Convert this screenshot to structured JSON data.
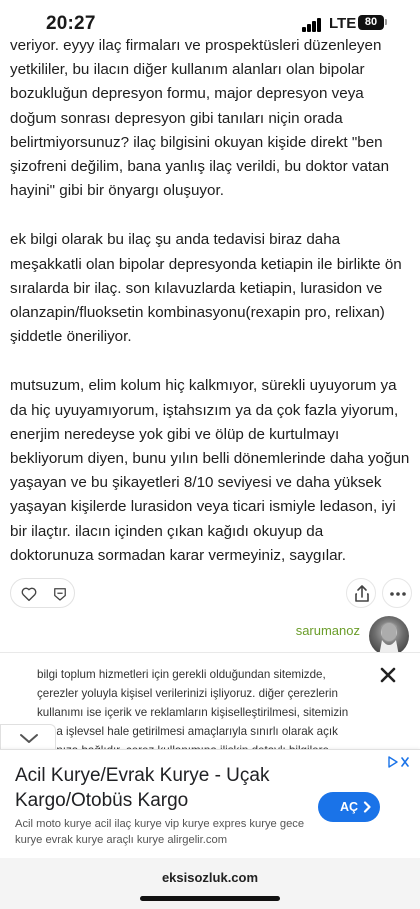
{
  "status_bar": {
    "time": "20:27",
    "network": "LTE",
    "battery": "80"
  },
  "entry": {
    "paragraphs": [
      "veriyor. eyyy ilaç firmaları ve prospektüsleri düzenleyen yetkililer, bu ilacın diğer kullanım alanları olan bipolar bozukluğun depresyon formu, major depresyon veya doğum sonrası depresyon gibi tanıları niçin orada belirtmiyorsunuz? ilaç bilgisini okuyan kişide direkt \"ben şizofreni değilim, bana yanlış ilaç verildi, bu doktor vatan hayini\" gibi bir önyargı oluşuyor.",
      "ek bilgi olarak bu ilaç şu anda tedavisi biraz daha meşakkatli olan bipolar depresyonda ketiapin ile birlikte ön sıralarda bir ilaç. son kılavuzlarda ketiapin, lurasidon ve olanzapin/fluoksetin kombinasyonu(rexapin pro, relixan) şiddetle öneriliyor.",
      "mutsuzum, elim kolum hiç kalkmıyor, sürekli uyuyorum ya da hiç uyuyamıyorum, iştahsızım ya da çok fazla yiyorum, enerjim neredeyse yok gibi ve ölüp de kurtulmayı bekliyorum diyen, bunu yılın belli dönemlerinde daha yoğun yaşayan ve bu şikayetleri 8/10 seviyesi ve daha yüksek yaşayan kişilerde lurasidon veya ticari ismiyle ledason, iyi bir ilaçtır. ilacın içinden çıkan kağıdı okuyup da doktorunuza sormadan karar vermeyiniz, saygılar."
    ],
    "author": "sarumanoz"
  },
  "cookie_banner": {
    "text": "bilgi toplum hizmetleri için gerekli olduğundan sitemizde, çerezler yoluyla kişisel verilerinizi işliyoruz. diğer çerezlerin kullanımı ise içerik ve reklamların kişiselleştirilmesi, sitemizin daha işlevsel hale getirilmesi amaçlarıyla sınırlı olarak açık rızanıza bağlıdır. çerez kullanımına ilişkin detaylı bilgilere"
  },
  "ad": {
    "title": "Acil Kurye/Evrak Kurye - Uçak Kargo/Otobüs Kargo",
    "description": "Acil moto kurye acil ilaç kurye vip kurye expres kurye gece kurye evrak kurye araçlı kurye alirgelir.com",
    "button_label": "AÇ",
    "accent_color": "#1a73e8"
  },
  "browser": {
    "url": "eksisozluk.com"
  },
  "colors": {
    "author": "#6b9d2a",
    "text": "#1e1e1e"
  }
}
